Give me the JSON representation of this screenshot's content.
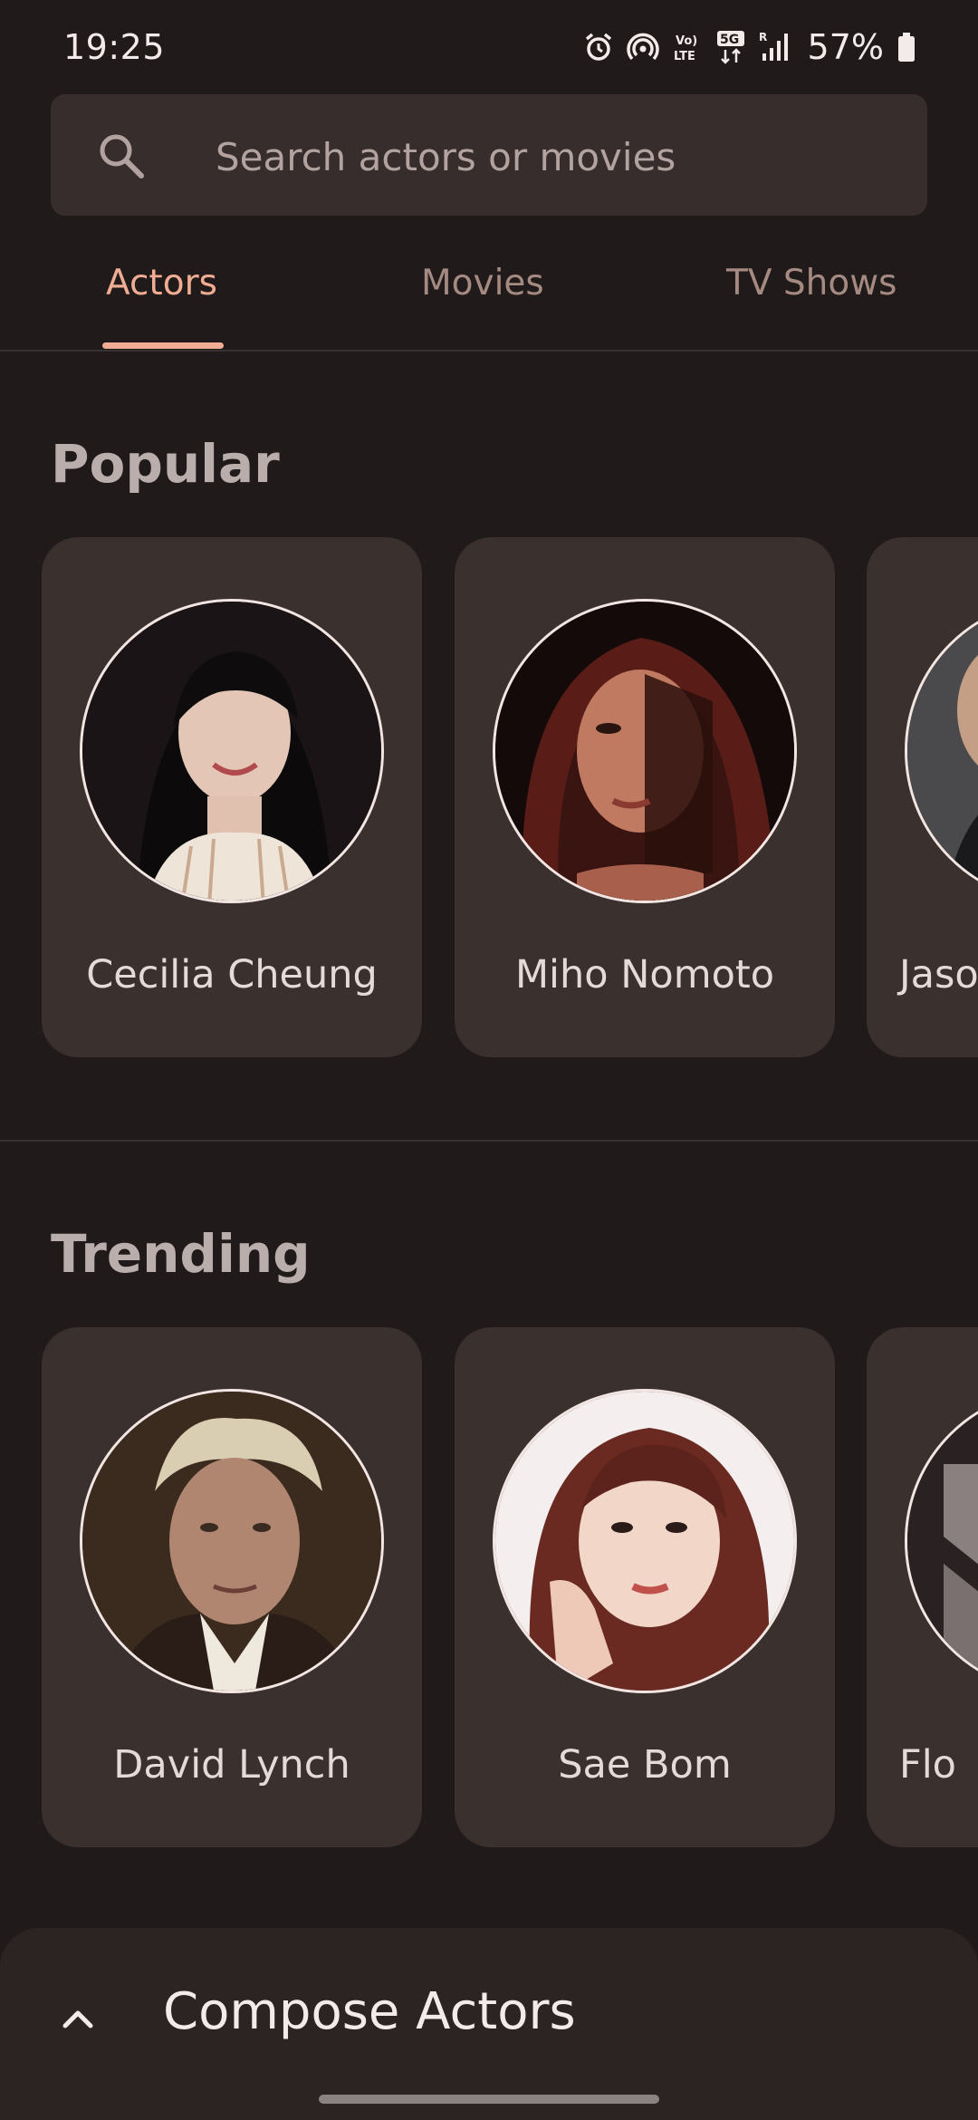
{
  "status_bar": {
    "time": "19:25",
    "battery": "57%"
  },
  "search": {
    "placeholder": "Search actors or movies"
  },
  "tabs": [
    {
      "label": "Actors",
      "active": true
    },
    {
      "label": "Movies",
      "active": false
    },
    {
      "label": "TV Shows",
      "active": false
    }
  ],
  "sections": [
    {
      "title": "Popular",
      "actors": [
        {
          "name": "Cecilia Cheung"
        },
        {
          "name": "Miho Nomoto"
        },
        {
          "name": "Jaso"
        }
      ]
    },
    {
      "title": "Trending",
      "actors": [
        {
          "name": "David Lynch"
        },
        {
          "name": "Sae Bom"
        },
        {
          "name": "Flo"
        }
      ]
    }
  ],
  "bottom_sheet": {
    "title": "Compose Actors"
  },
  "colors": {
    "accent": "#f0ad93",
    "background": "#211a1a",
    "card": "#3a302e"
  }
}
